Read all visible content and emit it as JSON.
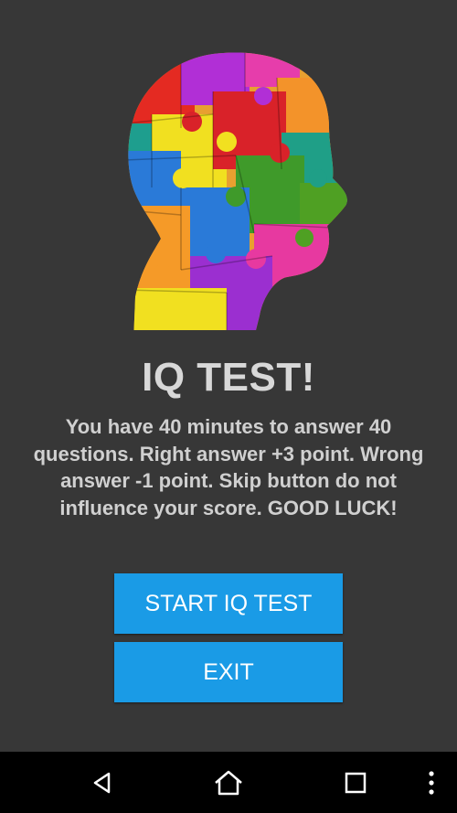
{
  "app": {
    "title": "IQ TEST!",
    "description": "You have 40 minutes to answer 40 questions. Right answer +3 point. Wrong answer -1 point. Skip button do not influence your score. GOOD LUCK!",
    "logo_icon": "puzzle-head-icon"
  },
  "buttons": {
    "start_label": "START IQ TEST",
    "exit_label": "EXIT",
    "color": "#1a9be6"
  },
  "navbar": {
    "icons": [
      "back-icon",
      "home-icon",
      "recents-icon",
      "overflow-menu-icon"
    ]
  },
  "colors": {
    "background": "#373737",
    "text": "#d8d8d8",
    "navbar": "#000000"
  }
}
